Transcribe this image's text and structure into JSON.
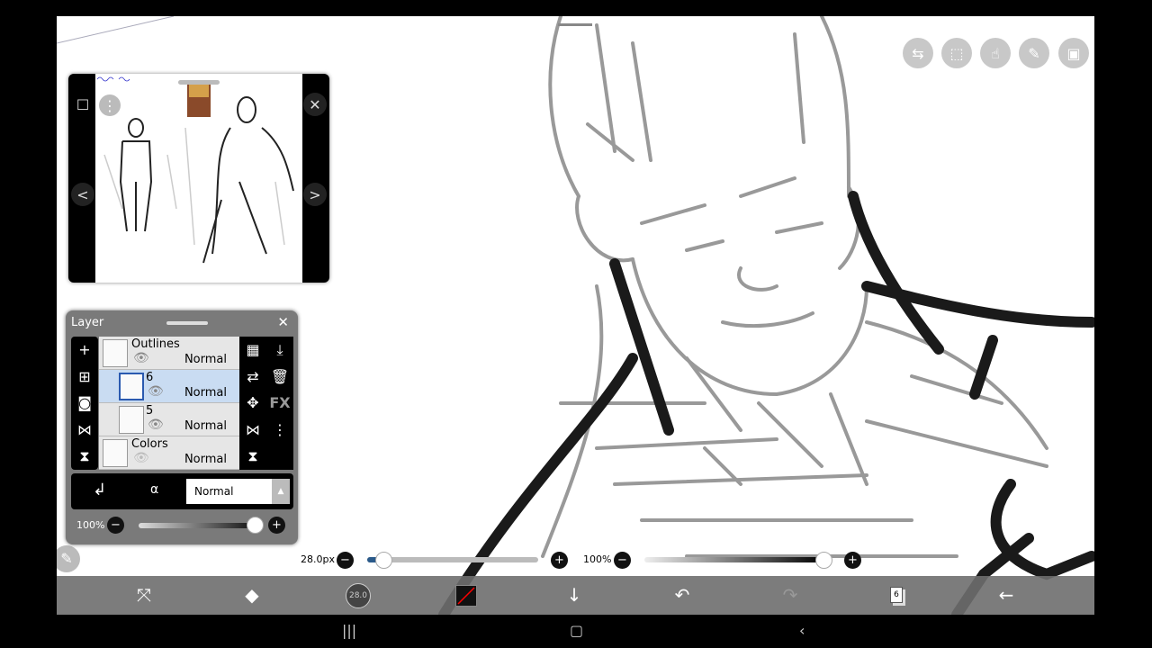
{
  "top_toolbar": {
    "icons": [
      "toggle-icon",
      "selection-icon",
      "touch-icon",
      "ruler-icon",
      "image-icon"
    ]
  },
  "reference_window": {
    "close": "✕",
    "prev": "<",
    "next": ">"
  },
  "layer_panel": {
    "title": "Layer",
    "close": "✕",
    "layers": [
      {
        "name": "Outlines",
        "blend": "Normal",
        "type": "folder"
      },
      {
        "name": "6",
        "blend": "Normal",
        "selected": true
      },
      {
        "name": "5",
        "blend": "Normal"
      },
      {
        "name": "Colors",
        "blend": "Normal",
        "type": "folder"
      }
    ],
    "blend_mode": "Normal",
    "opacity": "100%",
    "opacity_value": 100,
    "fx_label": "FX"
  },
  "brush_bar": {
    "size": "28.0px",
    "size_fraction": 0.1,
    "opacity": "100%",
    "opacity_value": 100
  },
  "bottom_toolbar": {
    "brush_size": "28.0",
    "layer_count": "6"
  },
  "colors": {
    "accent": "#2a5a8a",
    "panel": "#7a7a7a",
    "toolbar": "#6e6e6e",
    "selected_row": "#c9dcf2"
  }
}
